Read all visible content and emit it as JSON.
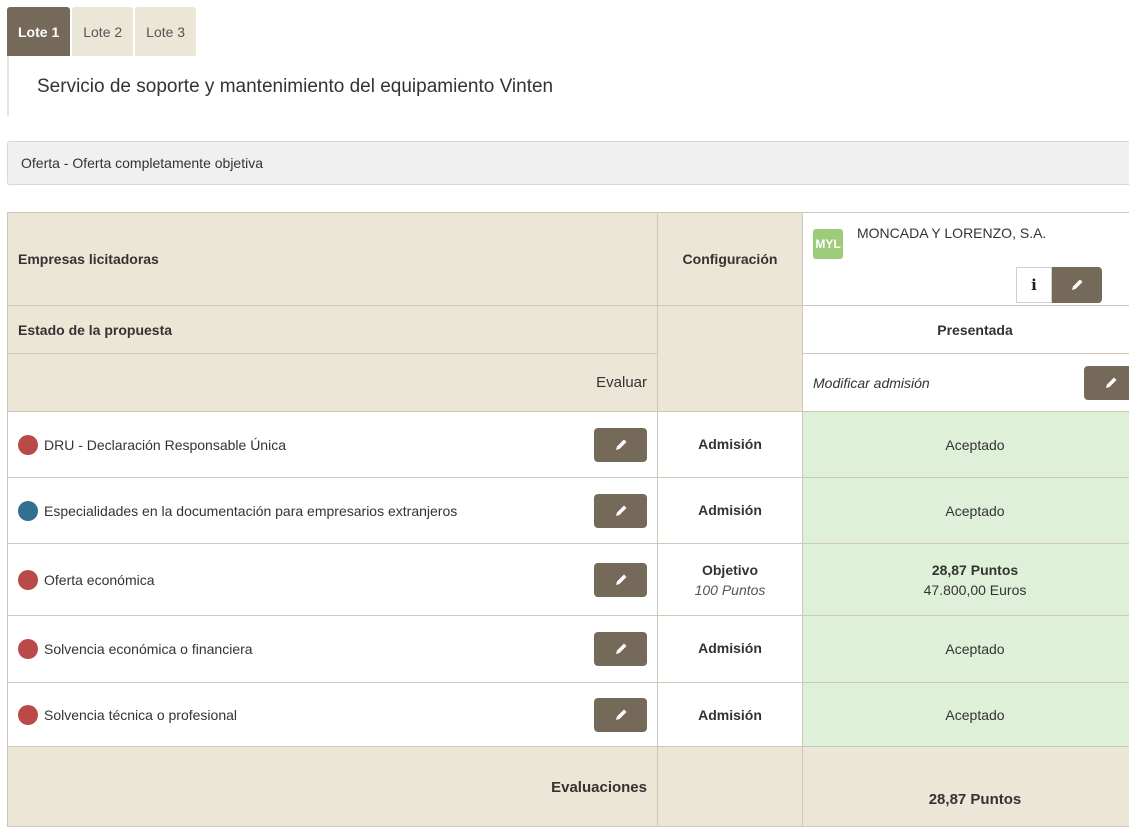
{
  "tabs": [
    {
      "label": "Lote 1",
      "active": true
    },
    {
      "label": "Lote 2",
      "active": false
    },
    {
      "label": "Lote 3",
      "active": false
    }
  ],
  "lot_title": "Servicio de soporte y mantenimiento del equipamiento Vinten",
  "offer_bar": "Oferta - Oferta completamente objetiva",
  "table": {
    "header_companies": "Empresas licitadoras",
    "header_config": "Configuración",
    "company": {
      "avatar": "MYL",
      "name": "MONCADA Y LORENZO, S.A.",
      "info_icon": "i"
    },
    "status_label": "Estado de la propuesta",
    "status_value": "Presentada",
    "evaluate_label": "Evaluar",
    "modify_admission": "Modificar admisión",
    "criteria": [
      {
        "label": "DRU - Declaración Responsable Única",
        "dot_color": "#b94a48",
        "config": "Admisión",
        "config_sub": "",
        "result": "Aceptado",
        "result_sub": ""
      },
      {
        "label": "Especialidades en la documentación para empresarios extranjeros",
        "dot_color": "#31708f",
        "config": "Admisión",
        "config_sub": "",
        "result": "Aceptado",
        "result_sub": ""
      },
      {
        "label": "Oferta económica",
        "dot_color": "#b94a48",
        "config": "Objetivo",
        "config_sub": "100 Puntos",
        "result": "28,87 Puntos",
        "result_sub": "47.800,00 Euros"
      },
      {
        "label": "Solvencia económica o financiera",
        "dot_color": "#b94a48",
        "config": "Admisión",
        "config_sub": "",
        "result": "Aceptado",
        "result_sub": ""
      },
      {
        "label": "Solvencia técnica o profesional",
        "dot_color": "#b94a48",
        "config": "Admisión",
        "config_sub": "",
        "result": "Aceptado",
        "result_sub": ""
      }
    ],
    "evaluations_label": "Evaluaciones",
    "evaluations_total": "28,87 Puntos"
  },
  "colors": {
    "accent": "#75695a",
    "beige": "#ece6d6",
    "success_bg": "#dff0d8",
    "success_text": "#3c763d"
  }
}
